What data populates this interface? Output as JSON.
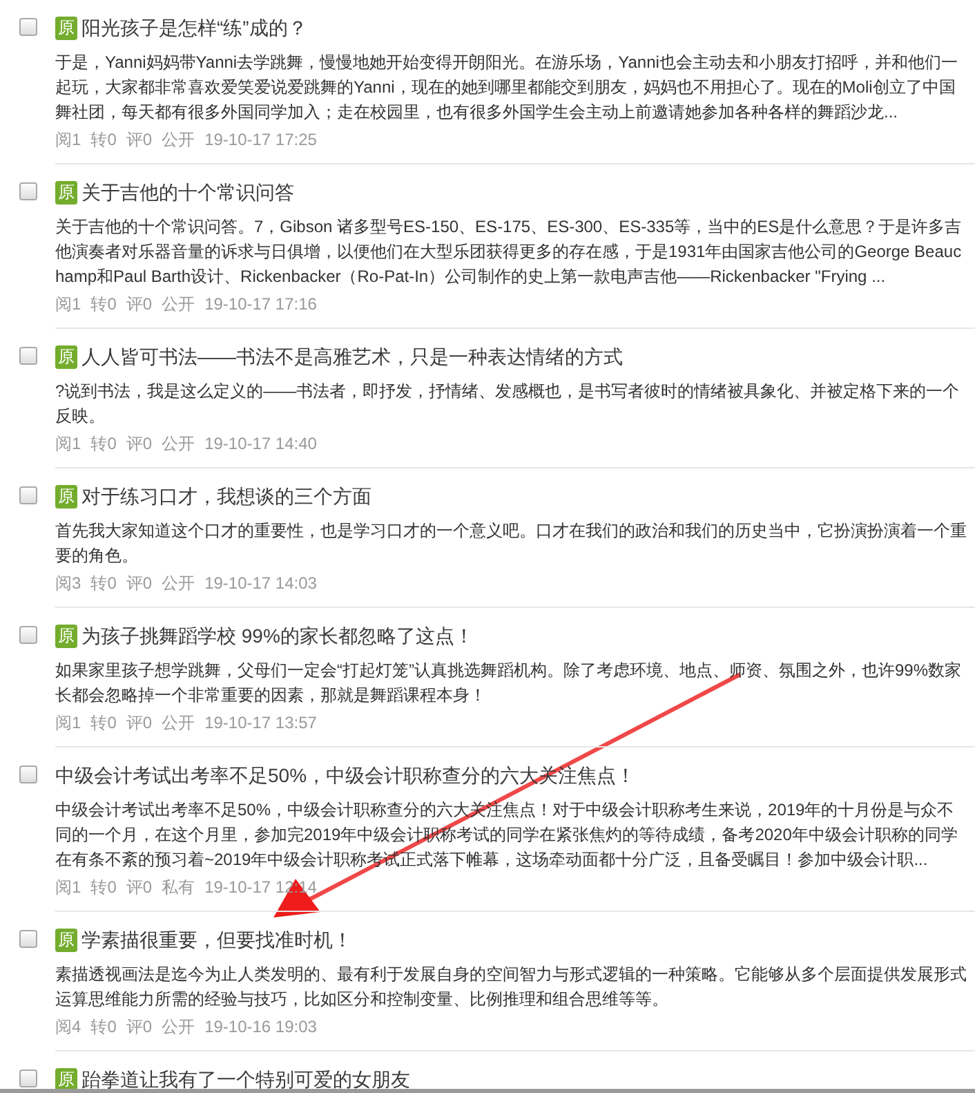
{
  "posts": [
    {
      "checked": false,
      "badge": "原",
      "title": "阳光孩子是怎样“练”成的？",
      "summary": "于是，Yanni妈妈带Yanni去学跳舞，慢慢地她开始变得开朗阳光。在游乐场，Yanni也会主动去和小朋友打招呼，并和他们一起玩，大家都非常喜欢爱笑爱说爱跳舞的Yanni，现在的她到哪里都能交到朋友，妈妈也不用担心了。现在的Moli创立了中国舞社团，每天都有很多外国同学加入；走在校园里，也有很多外国学生会主动上前邀请她参加各种各样的舞蹈沙龙...",
      "reads": "阅1",
      "reposts": "转0",
      "comments": "评0",
      "visibility": "公开",
      "time": "19-10-17 17:25"
    },
    {
      "checked": false,
      "badge": "原",
      "title": "关于吉他的十个常识问答",
      "summary": "关于吉他的十个常识问答。7，Gibson 诸多型号ES-150、ES-175、ES-300、ES-335等，当中的ES是什么意思？于是许多吉他演奏者对乐器音量的诉求与日俱增，以便他们在大型乐团获得更多的存在感，于是1931年由国家吉他公司的George Beauchamp和Paul Barth设计、Rickenbacker（Ro-Pat-In）公司制作的史上第一款电声吉他——Rickenbacker \"Frying ...",
      "reads": "阅1",
      "reposts": "转0",
      "comments": "评0",
      "visibility": "公开",
      "time": "19-10-17 17:16"
    },
    {
      "checked": false,
      "badge": "原",
      "title": "人人皆可书法——书法不是高雅艺术，只是一种表达情绪的方式",
      "summary": "?说到书法，我是这么定义的——书法者，即抒发，抒情绪、发感概也，是书写者彼时的情绪被具象化、并被定格下来的一个反映。",
      "reads": "阅1",
      "reposts": "转0",
      "comments": "评0",
      "visibility": "公开",
      "time": "19-10-17 14:40"
    },
    {
      "checked": false,
      "badge": "原",
      "title": "对于练习口才，我想谈的三个方面",
      "summary": "首先我大家知道这个口才的重要性，也是学习口才的一个意义吧。口才在我们的政治和我们的历史当中，它扮演扮演着一个重要的角色。",
      "reads": "阅3",
      "reposts": "转0",
      "comments": "评0",
      "visibility": "公开",
      "time": "19-10-17 14:03"
    },
    {
      "checked": false,
      "badge": "原",
      "title": "为孩子挑舞蹈学校 99%的家长都忽略了这点！",
      "summary": "如果家里孩子想学跳舞，父母们一定会“打起灯笼”认真挑选舞蹈机构。除了考虑环境、地点、师资、氛围之外，也许99%数家长都会忽略掉一个非常重要的因素，那就是舞蹈课程本身！",
      "reads": "阅1",
      "reposts": "转0",
      "comments": "评0",
      "visibility": "公开",
      "time": "19-10-17 13:57"
    },
    {
      "checked": false,
      "title": "中级会计考试出考率不足50%，中级会计职称查分的六大关注焦点！",
      "summary": "中级会计考试出考率不足50%，中级会计职称查分的六大关注焦点！对于中级会计职称考生来说，2019年的十月份是与众不同的一个月，在这个月里，参加完2019年中级会计职称考试的同学在紧张焦灼的等待成绩，备考2020年中级会计职称的同学在有条不紊的预习着~2019年中级会计职称考试正式落下帷幕，这场牵动面都十分广泛，且备受瞩目！参加中级会计职...",
      "reads": "阅1",
      "reposts": "转0",
      "comments": "评0",
      "visibility": "私有",
      "time": "19-10-17 12:14"
    },
    {
      "checked": false,
      "badge": "原",
      "title": "学素描很重要，但要找准时机！",
      "summary": "素描透视画法是迄今为止人类发明的、最有利于发展自身的空间智力与形式逻辑的一种策略。它能够从多个层面提供发展形式运算思维能力所需的经验与技巧，比如区分和控制变量、比例推理和组合思维等等。",
      "reads": "阅4",
      "reposts": "转0",
      "comments": "评0",
      "visibility": "公开",
      "time": "19-10-16 19:03"
    },
    {
      "checked": false,
      "badge": "原",
      "title": "跆拳道让我有了一个特别可爱的女朋友"
    }
  ]
}
